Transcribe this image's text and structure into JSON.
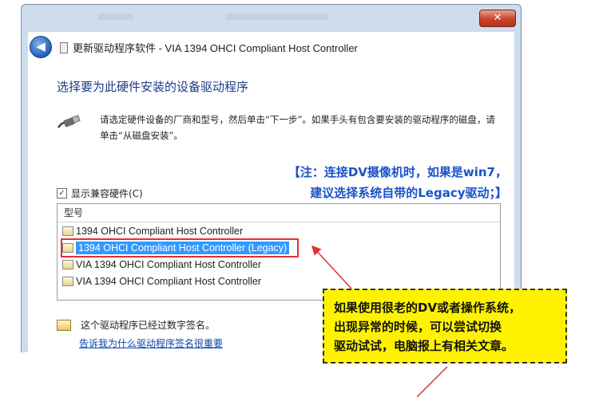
{
  "window": {
    "close_label": "✕",
    "back_label": "◀",
    "title": "更新驱动程序软件 - VIA 1394 OHCI Compliant Host Controller"
  },
  "content": {
    "heading": "选择要为此硬件安装的设备驱动程序",
    "instructions": "请选定硬件设备的厂商和型号，然后单击“下一步”。如果手头有包含要安装的驱动程序的磁盘，请单击“从磁盘安装”。",
    "annotation_line1": "【注：连接DV摄像机时，如果是win7，",
    "annotation_line2": "建议选择系统自带的Legacy驱动；】",
    "compat_label": "显示兼容硬件(C)",
    "compat_checked": true,
    "list_header": "型号",
    "models": [
      "1394 OHCI Compliant Host Controller",
      "1394 OHCI Compliant Host Controller (Legacy)",
      "VIA 1394 OHCI Compliant Host Controller",
      "VIA 1394 OHCI Compliant Host Controller"
    ],
    "selected_index": 1,
    "signed_text": "这个驱动程序已经过数字签名。",
    "signing_link": "告诉我为什么驱动程序签名很重要"
  },
  "callout": {
    "lines": [
      "如果使用很老的DV或者操作系统，",
      "出现异常的时候，可以尝试切换",
      "驱动试试，电脑报上有相关文章。"
    ]
  },
  "colors": {
    "annotation": "#1a52c9",
    "highlight": "#e03131",
    "callout_bg": "#fff200",
    "selection": "#3399ff"
  },
  "icons": [
    "back-arrow-icon",
    "close-icon",
    "usb-plug-icon",
    "driver-icon",
    "certificate-icon",
    "checkmark-icon"
  ]
}
